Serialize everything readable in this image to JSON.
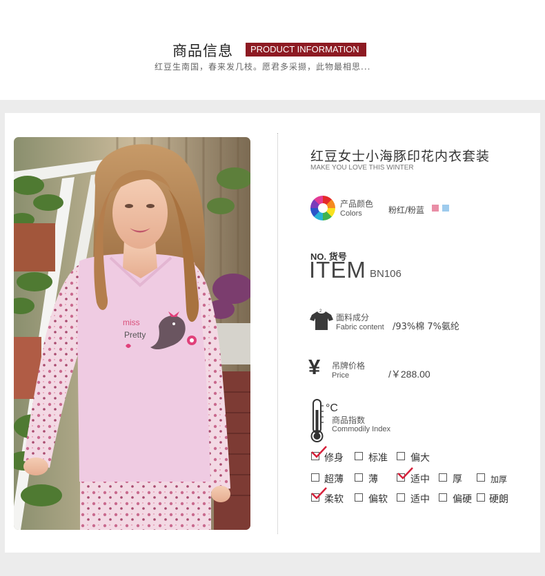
{
  "header": {
    "title": "商品信息",
    "badge": "PRODUCT INFORMATION",
    "subtitle": "红豆生南国，春来发几枝。愿君多采撷，此物最相思..."
  },
  "product": {
    "name": "红豆女士小海豚印花内衣套装",
    "tagline": "MAKE YOU LOVE THIS WINTER",
    "print_text": "miss Pretty"
  },
  "colors": {
    "label_cn": "产品颜色",
    "label_en": "Colors",
    "value": "粉红/粉蓝",
    "swatches": [
      "#e98ea6",
      "#9ecbed"
    ]
  },
  "item": {
    "label_prefix": "NO. 货号",
    "label_big": "ITEM",
    "code": "BN106"
  },
  "fabric": {
    "icon": "t-shirt-icon",
    "label_cn": "面料成分",
    "label_en": "Fabric content",
    "value": "/93%棉 7%氨纶"
  },
  "price": {
    "icon": "yen-icon",
    "symbol": "¥",
    "label_cn": "吊牌价格",
    "label_en": "Price",
    "value": "/￥288.00"
  },
  "index": {
    "icon": "thermometer-icon",
    "unit": "°C",
    "label_cn": "商品指数",
    "label_en": "Commodily Index",
    "rows": [
      [
        {
          "label": "修身",
          "checked": true
        },
        {
          "label": "标准",
          "checked": false
        },
        {
          "label": "偏大",
          "checked": false
        }
      ],
      [
        {
          "label": "超薄",
          "checked": false
        },
        {
          "label": "薄",
          "checked": false
        },
        {
          "label": "适中",
          "checked": true
        },
        {
          "label": "厚",
          "checked": false
        },
        {
          "label": "加厚",
          "checked": false
        }
      ],
      [
        {
          "label": "柔软",
          "checked": true
        },
        {
          "label": "偏软",
          "checked": false
        },
        {
          "label": "适中",
          "checked": false
        },
        {
          "label": "偏硬",
          "checked": false
        },
        {
          "label": "硬朗",
          "checked": false
        }
      ]
    ]
  },
  "accent_color": "#8d1a22",
  "check_color": "#d6203a"
}
